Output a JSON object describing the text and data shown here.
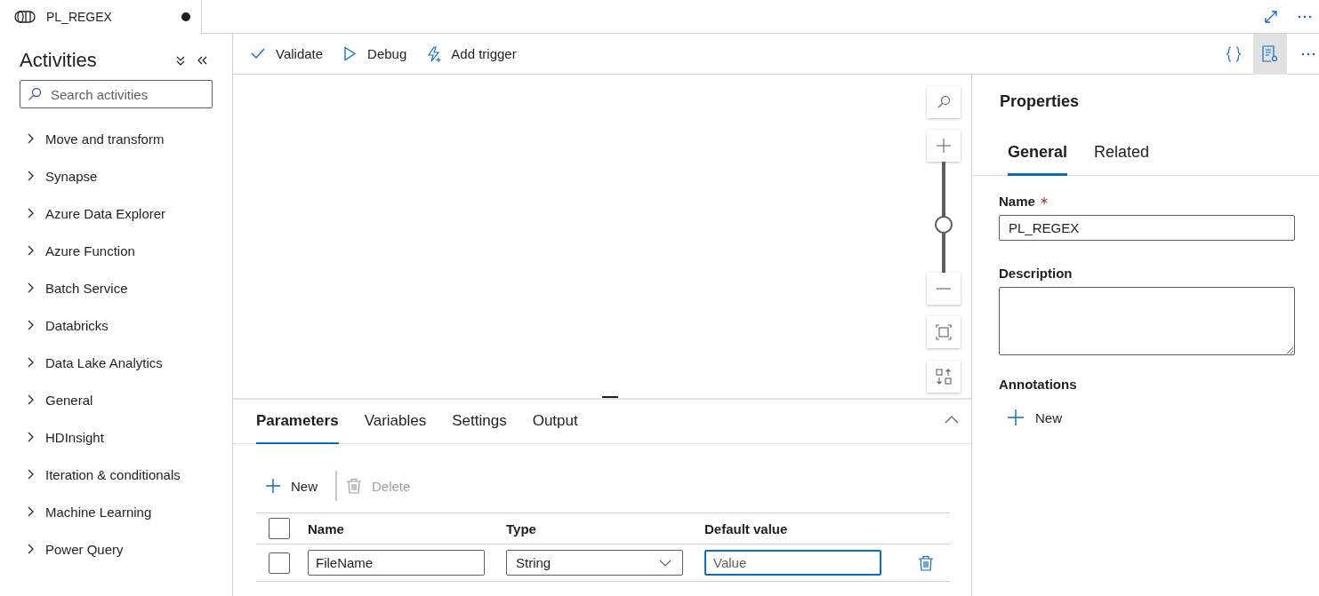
{
  "document_tab": {
    "title": "PL_REGEX",
    "unsaved": true
  },
  "activities": {
    "title": "Activities",
    "search": {
      "placeholder": "Search activities"
    },
    "items": [
      {
        "label": "Move and transform",
        "expanded": false
      },
      {
        "label": "Synapse",
        "expanded": false
      },
      {
        "label": "Azure Data Explorer",
        "expanded": false
      },
      {
        "label": "Azure Function",
        "expanded": false
      },
      {
        "label": "Batch Service",
        "expanded": false
      },
      {
        "label": "Databricks",
        "expanded": false
      },
      {
        "label": "Data Lake Analytics",
        "expanded": false
      },
      {
        "label": "General",
        "expanded": false
      },
      {
        "label": "HDInsight",
        "expanded": false
      },
      {
        "label": "Iteration & conditionals",
        "expanded": false
      },
      {
        "label": "Machine Learning",
        "expanded": false
      },
      {
        "label": "Power Query",
        "expanded": false
      }
    ]
  },
  "canvas": {
    "zoom": {
      "level": 0.42
    }
  },
  "toolbar": {
    "buttons": [
      {
        "kind": "validate",
        "label": "Validate"
      },
      {
        "kind": "debug",
        "label": "Debug"
      },
      {
        "kind": "trigger",
        "label": "Add trigger"
      }
    ],
    "properties_toggle_selected": true
  },
  "bottom_panel": {
    "tabs": [
      {
        "label": "Parameters",
        "selected": true
      },
      {
        "label": "Variables",
        "selected": false
      },
      {
        "label": "Settings",
        "selected": false
      },
      {
        "label": "Output",
        "selected": false
      }
    ],
    "actions": [
      {
        "kind": "new",
        "label": "New",
        "disabled": false
      },
      {
        "kind": "delete",
        "label": "Delete",
        "disabled": true
      }
    ],
    "table": {
      "columns": [
        "Name",
        "Type",
        "Default value"
      ],
      "select_all_checked": false,
      "rows": [
        {
          "checked": false,
          "name": "FileName",
          "type": "String",
          "default_value_placeholder": "Value",
          "focused": true
        }
      ]
    }
  },
  "properties": {
    "title": "Properties",
    "tabs": [
      {
        "label": "General",
        "selected": true
      },
      {
        "label": "Related",
        "selected": false
      }
    ],
    "name_label": "Name",
    "name_required": true,
    "name_value": "PL_REGEX",
    "description_label": "Description",
    "annotations_label": "Annotations",
    "new_label": "New"
  }
}
